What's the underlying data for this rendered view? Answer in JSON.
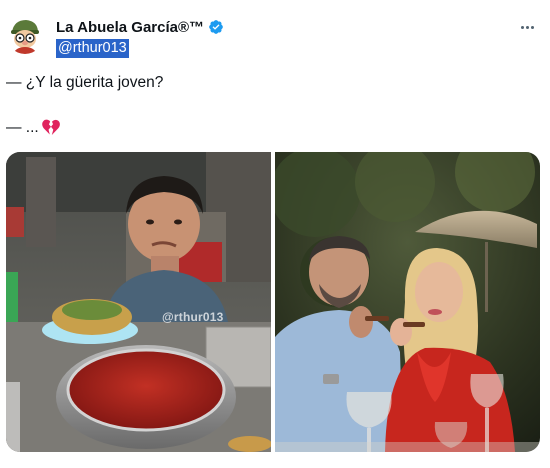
{
  "author": {
    "display_name": "La Abuela García®™",
    "handle": "@rthur013",
    "verified": true,
    "avatar_icon": "cartoon-grandma-avatar"
  },
  "tweet": {
    "line1": "— ¿Y la güerita joven?",
    "line2": "— ...",
    "line2_emoji": "broken-heart-icon"
  },
  "menu": {
    "more_icon": "more-options-icon"
  },
  "media": {
    "left_watermark": "@rthur013"
  },
  "colors": {
    "verified": "#1d9bf0",
    "handle_highlight": "#2a64c9",
    "heart": "#e0245e"
  }
}
